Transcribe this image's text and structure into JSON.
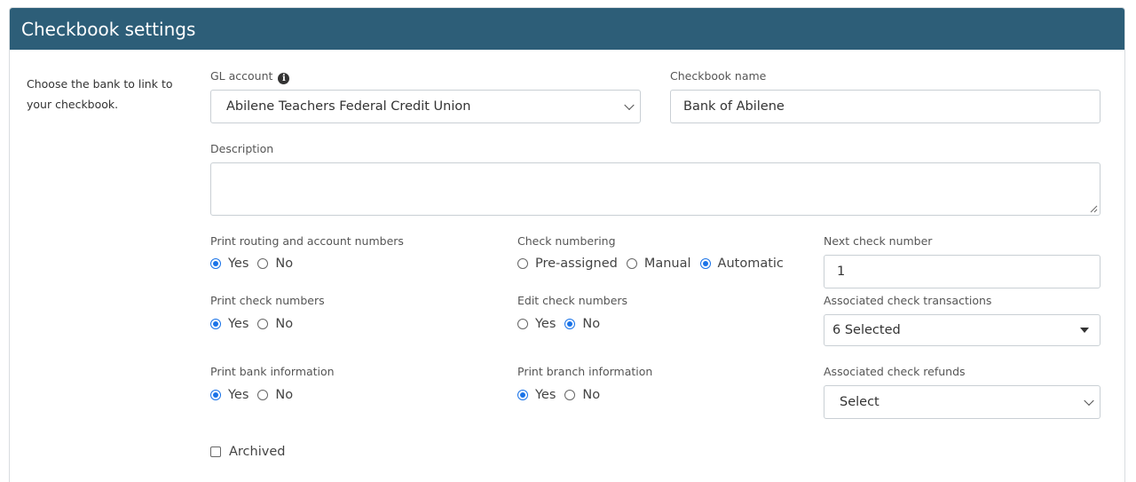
{
  "header": {
    "title": "Checkbook settings"
  },
  "sidebar": {
    "text": "Choose the bank to link to your checkbook."
  },
  "gl_account": {
    "label": "GL account",
    "value": "Abilene Teachers Federal Credit Union"
  },
  "checkbook_name": {
    "label": "Checkbook name",
    "value": "Bank of Abilene"
  },
  "description": {
    "label": "Description",
    "value": ""
  },
  "print_routing": {
    "label": "Print routing and account numbers",
    "options": [
      "Yes",
      "No"
    ],
    "selected": "Yes"
  },
  "check_numbering": {
    "label": "Check numbering",
    "options": [
      "Pre-assigned",
      "Manual",
      "Automatic"
    ],
    "selected": "Automatic"
  },
  "next_check_number": {
    "label": "Next check number",
    "value": "1"
  },
  "print_check_numbers": {
    "label": "Print check numbers",
    "options": [
      "Yes",
      "No"
    ],
    "selected": "Yes"
  },
  "edit_check_numbers": {
    "label": "Edit check numbers",
    "options": [
      "Yes",
      "No"
    ],
    "selected": "No"
  },
  "assoc_transactions": {
    "label": "Associated check transactions",
    "value": "6 Selected"
  },
  "print_bank_info": {
    "label": "Print bank information",
    "options": [
      "Yes",
      "No"
    ],
    "selected": "Yes"
  },
  "print_branch_info": {
    "label": "Print branch information",
    "options": [
      "Yes",
      "No"
    ],
    "selected": "Yes"
  },
  "assoc_refunds": {
    "label": "Associated check refunds",
    "value": "Select"
  },
  "archived": {
    "label": "Archived",
    "checked": false
  },
  "colors": {
    "header_bg": "#2d5e78",
    "accent": "#1a73e8"
  }
}
